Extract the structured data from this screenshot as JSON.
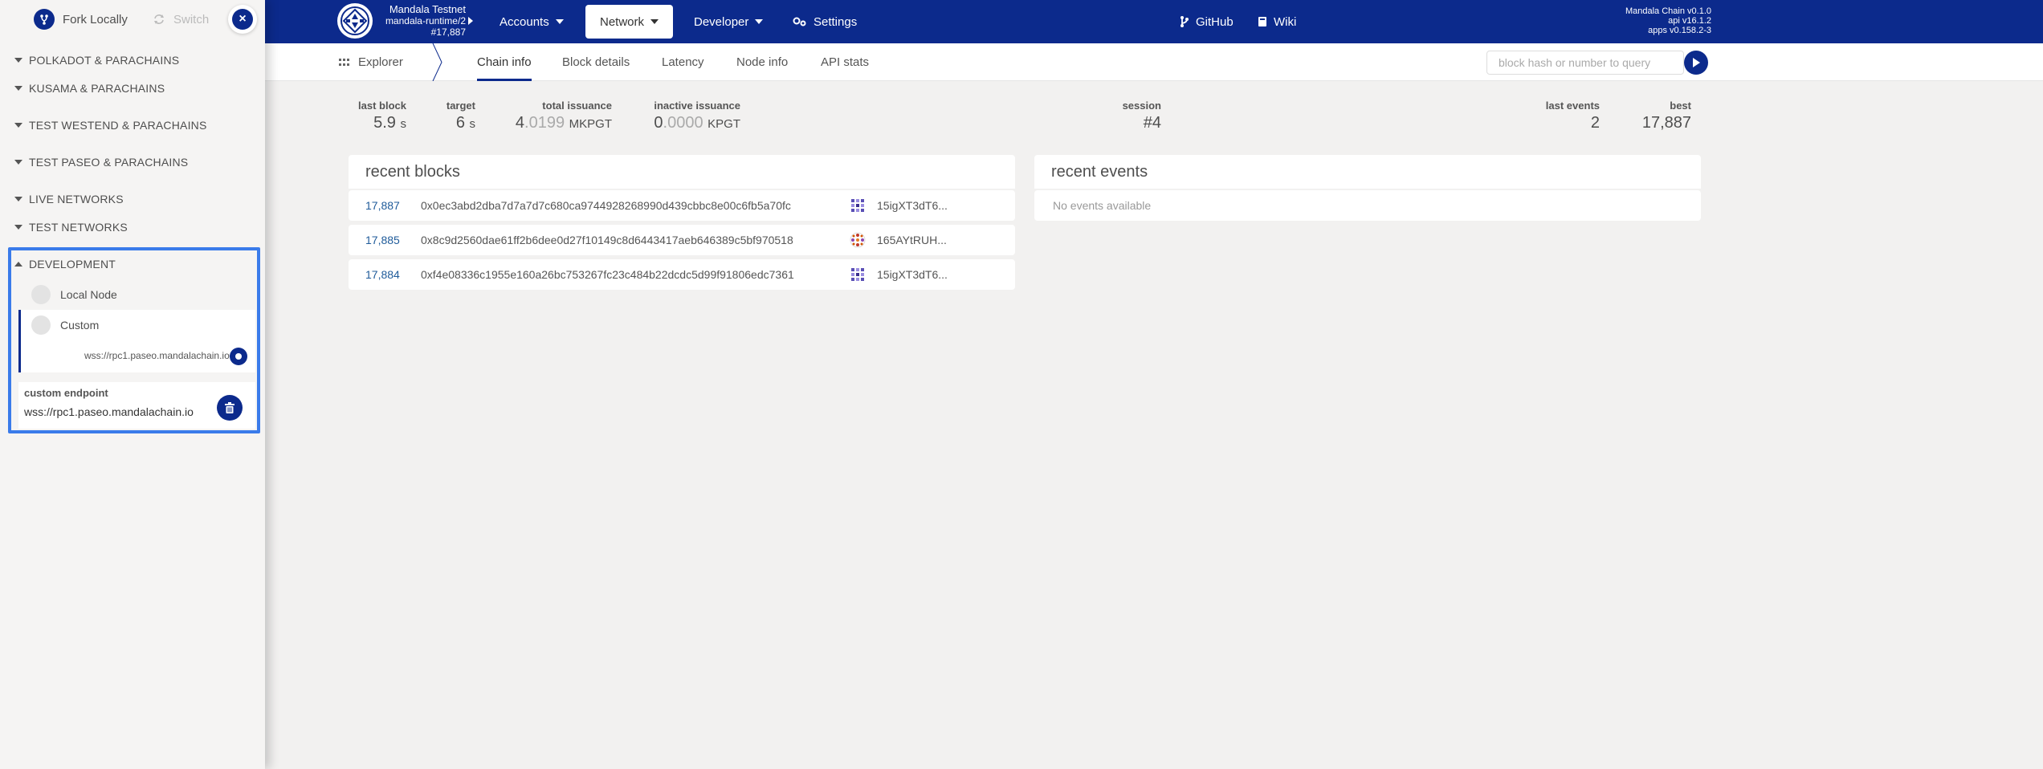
{
  "sidebar": {
    "fork_label": "Fork Locally",
    "switch_label": "Switch",
    "close_label": "×",
    "groups": [
      {
        "label": "POLKADOT & PARACHAINS"
      },
      {
        "label": "KUSAMA & PARACHAINS"
      },
      {
        "label": "TEST WESTEND & PARACHAINS"
      },
      {
        "label": "TEST PASEO & PARACHAINS"
      },
      {
        "label": "LIVE NETWORKS"
      },
      {
        "label": "TEST NETWORKS"
      },
      {
        "label": "DEVELOPMENT"
      }
    ],
    "development": {
      "items": [
        {
          "label": "Local Node"
        },
        {
          "label": "Custom",
          "url": "wss://rpc1.paseo.mandalachain.io",
          "selected": true
        }
      ],
      "endpoint_label": "custom endpoint",
      "endpoint_value": "wss://rpc1.paseo.mandalachain.io"
    }
  },
  "header": {
    "chain_name": "Mandala Testnet",
    "runtime": "mandala-runtime/2",
    "block": "#17,887",
    "menu": {
      "accounts": "Accounts",
      "network": "Network",
      "developer": "Developer",
      "settings": "Settings",
      "github": "GitHub",
      "wiki": "Wiki"
    },
    "versions": [
      "Mandala Chain v0.1.0",
      "api v16.1.2",
      "apps v0.158.2-3"
    ],
    "brand_color": "#0c2a8c"
  },
  "tabs": {
    "explorer": "Explorer",
    "items": [
      "Chain info",
      "Block details",
      "Latency",
      "Node info",
      "API stats"
    ],
    "active": "Chain info",
    "search_placeholder": "block hash or number to query"
  },
  "summary": {
    "last_block": {
      "label": "last block",
      "value": "5.9",
      "unit": "s"
    },
    "target": {
      "label": "target",
      "value": "6",
      "unit": "s"
    },
    "total_issuance": {
      "label": "total issuance",
      "int": "4",
      "dec": ".0199",
      "unit": "MKPGT"
    },
    "inactive_issuance": {
      "label": "inactive issuance",
      "int": "0",
      "dec": ".0000",
      "unit": "KPGT"
    },
    "session": {
      "label": "session",
      "value": "#4"
    },
    "last_events": {
      "label": "last events",
      "value": "2"
    },
    "best": {
      "label": "best",
      "value": "17,887"
    }
  },
  "recent_blocks": {
    "title": "recent blocks",
    "rows": [
      {
        "number": "17,887",
        "hash": "0x0ec3abd2dba7d7a7d7c680ca9744928268990d439cbbc8e00c6fb5a70fc",
        "author": "15igXT3dT6..."
      },
      {
        "number": "17,885",
        "hash": "0x8c9d2560dae61ff2b6dee0d27f10149c8d6443417aeb646389c5bf970518",
        "author": "165AYtRUH..."
      },
      {
        "number": "17,884",
        "hash": "0xf4e08336c1955e160a26bc753267fc23c484b22dcdc5d99f91806edc7361",
        "author": "15igXT3dT6..."
      }
    ]
  },
  "recent_events": {
    "title": "recent events",
    "empty": "No events available"
  }
}
